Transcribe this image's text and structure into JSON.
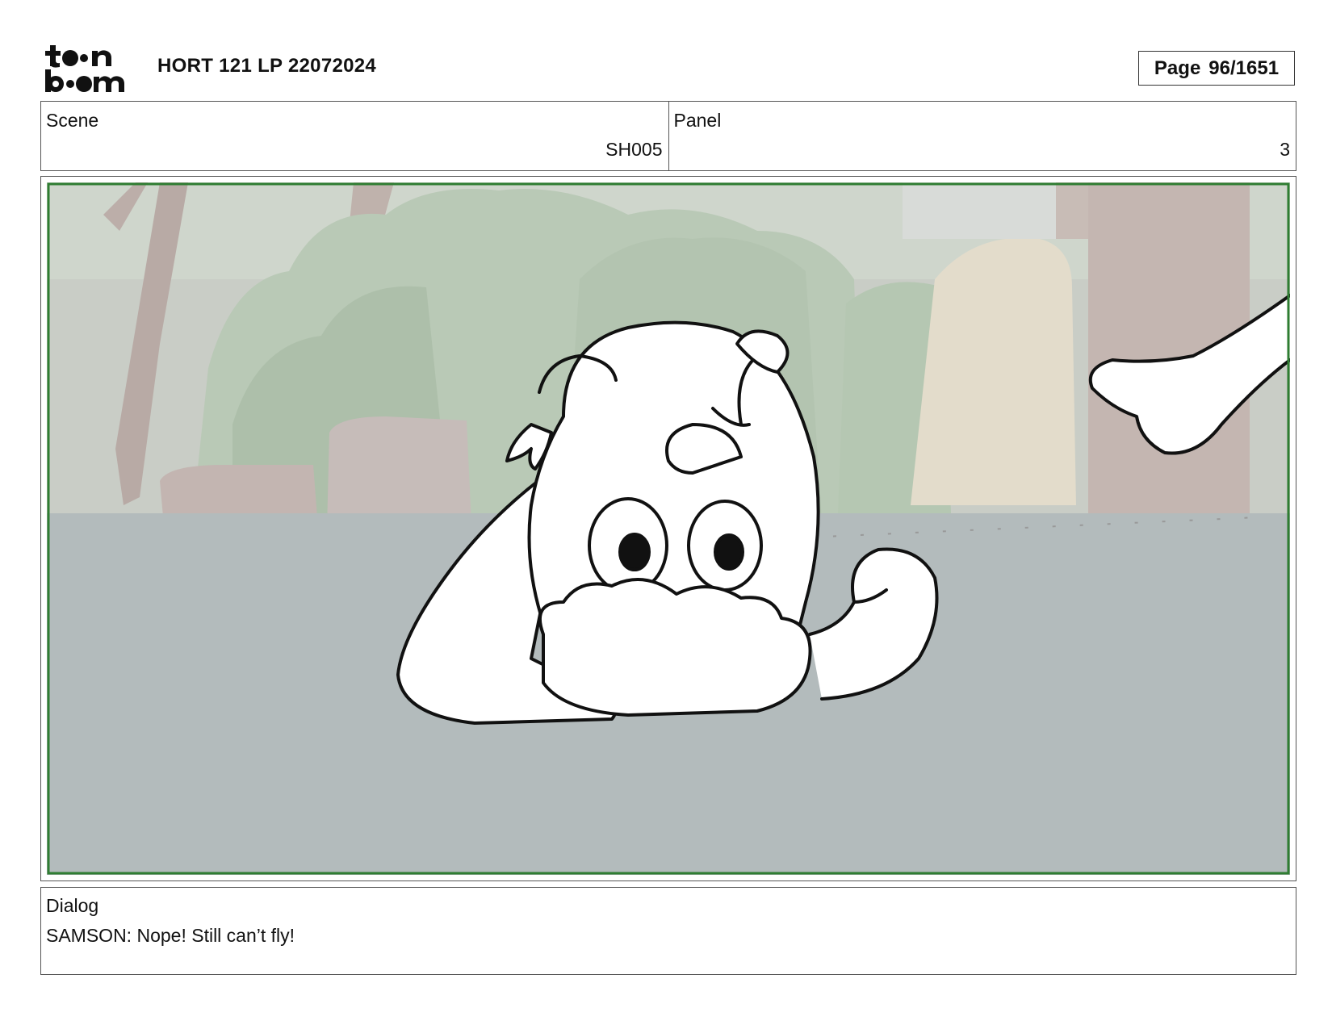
{
  "header": {
    "logo_text": "toon boom",
    "document_title": "HORT 121 LP 22072024",
    "page_label": "Page",
    "page_number": "96/1651"
  },
  "scene": {
    "label": "Scene",
    "value": "SH005"
  },
  "panel": {
    "label": "Panel",
    "value": "3"
  },
  "dialog": {
    "label": "Dialog",
    "text": "SAMSON: Nope! Still can’t fly!"
  },
  "colors": {
    "frame_border": "#2f7d32",
    "floor": "#b3bbbc",
    "foliage": "#b7ccb4",
    "sketch_stroke": "#111111"
  }
}
